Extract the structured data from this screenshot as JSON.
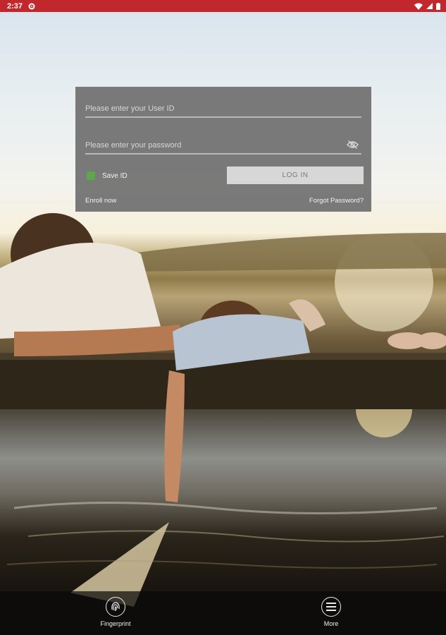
{
  "status_bar": {
    "time": "2:37",
    "icons": [
      "settings-icon",
      "wifi-icon",
      "signal-icon",
      "battery-icon"
    ],
    "background_color": "#c1272d"
  },
  "login": {
    "user_id_placeholder": "Please enter your User ID",
    "user_id_value": "",
    "password_placeholder": "Please enter your password",
    "password_value": "",
    "password_visibility_icon": "eye-off-icon",
    "save_id_label": "Save ID",
    "save_id_checked": true,
    "login_button_label": "LOG IN",
    "enroll_label": "Enroll now",
    "forgot_password_label": "Forgot Password?"
  },
  "bottom_nav": {
    "items": [
      {
        "label": "Fingerprint",
        "icon": "fingerprint-icon"
      },
      {
        "label": "More",
        "icon": "menu-icon"
      }
    ]
  },
  "colors": {
    "accent_green": "#5aa84a",
    "card_background": "#707070"
  }
}
